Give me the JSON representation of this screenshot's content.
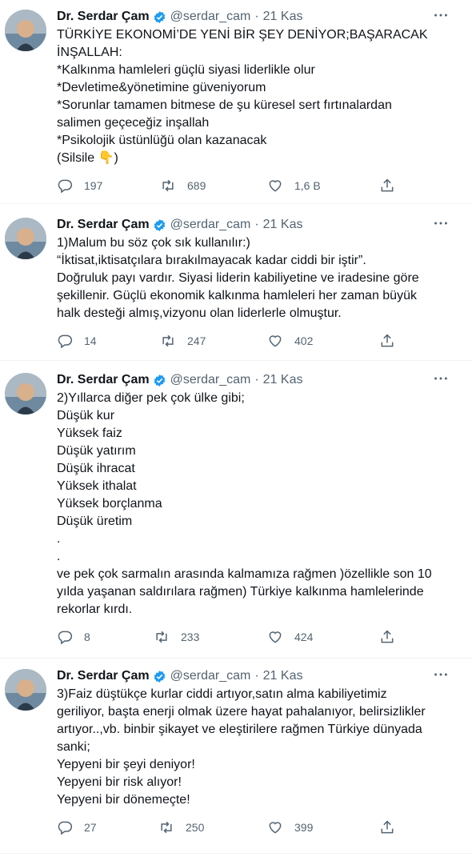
{
  "author": {
    "name": "Dr. Serdar Çam",
    "handle": "@serdar_cam",
    "dot": "·",
    "verified_icon": "verified-badge-icon"
  },
  "tweets": [
    {
      "date": "21 Kas",
      "text": "TÜRKİYE EKONOMİ’DE YENİ BİR ŞEY DENİYOR;BAŞARACAK\nİNŞALLAH:\n*Kalkınma hamleleri güçlü siyasi liderlikle olur\n*Devletime&yönetimine güveniyorum\n*Sorunlar tamamen bitmese de şu küresel sert fırtınalardan\nsalimen geçeceğiz inşallah\n*Psikolojik üstünlüğü olan kazanacak\n(Silsile 👇)",
      "replies": "197",
      "retweets": "689",
      "likes": "1,6 B"
    },
    {
      "date": "21 Kas",
      "text": "1)Malum bu söz çok sık kullanılır:)\n“İktisat,iktisatçılara bırakılmayacak kadar ciddi bir iştir”.\nDoğruluk payı vardır. Siyasi liderin kabiliyetine ve iradesine göre\nşekillenir. Güçlü ekonomik kalkınma hamleleri her zaman büyük\nhalk desteği almış,vizyonu olan liderlerle olmuştur.",
      "replies": "14",
      "retweets": "247",
      "likes": "402"
    },
    {
      "date": "21 Kas",
      "text": "2)Yıllarca diğer pek çok ülke gibi;\nDüşük kur\nYüksek faiz\nDüşük yatırım\nDüşük ihracat\nYüksek ithalat\nYüksek borçlanma\nDüşük üretim\n.\n.\nve pek çok sarmalın arasında kalmamıza rağmen )özellikle son 10\nyılda yaşanan saldırılara rağmen) Türkiye kalkınma hamlelerinde\nrekorlar kırdı.",
      "replies": "8",
      "retweets": "233",
      "likes": "424"
    },
    {
      "date": "21 Kas",
      "text": "3)Faiz düştükçe kurlar ciddi artıyor,satın alma kabiliyetimiz\ngeriliyor, başta enerji olmak üzere hayat pahalanıyor, belirsizlikler\nartıyor..,vb. binbir şikayet ve eleştirilere rağmen Türkiye dünyada\nsanki;\nYepyeni bir şeyi deniyor!\nYepyeni bir risk alıyor!\nYepyeni bir dönemeçte!",
      "replies": "27",
      "retweets": "250",
      "likes": "399"
    }
  ],
  "icons": {
    "reply": "reply-icon",
    "retweet": "retweet-icon",
    "like": "like-icon",
    "share": "share-icon",
    "more": "more-options-icon"
  },
  "colors": {
    "text": "#0f1419",
    "secondary": "#536471",
    "verified": "#1d9bf0",
    "divider": "#eff3f4"
  }
}
